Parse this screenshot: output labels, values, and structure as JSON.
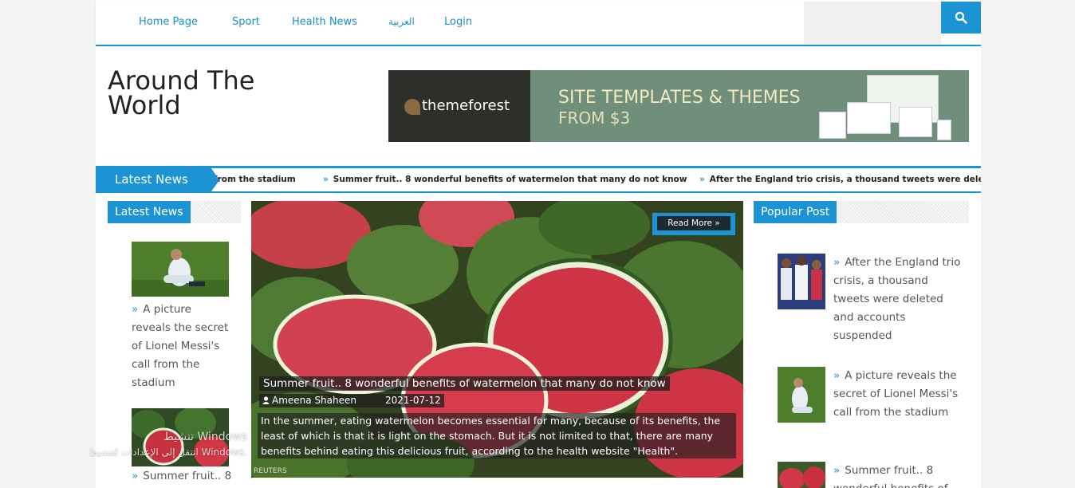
{
  "nav": {
    "items": [
      "Home Page",
      "Sport",
      "Health News",
      "العربية",
      "Login"
    ]
  },
  "site": {
    "title_line1": "Around The",
    "title_line2": "World"
  },
  "banner": {
    "brand": "themeforest",
    "line1": "SITE TEMPLATES & THEMES",
    "line2": "FROM $3"
  },
  "ticker": {
    "label": "Latest News",
    "items": [
      "from the stadium",
      "Summer fruit.. 8 wonderful benefits of watermelon that many do not know",
      "After the England trio crisis, a thousand tweets were deleted"
    ]
  },
  "latest": {
    "heading": "Latest News",
    "items": [
      {
        "title": "A picture reveals the secret of Lionel Messi's call from the stadium"
      },
      {
        "title": "Summer fruit.. 8"
      }
    ]
  },
  "hero": {
    "read_more": "Read More »",
    "title": "Summer fruit.. 8 wonderful benefits of watermelon that many do not know",
    "author": "Ameena Shaheen",
    "date": "2021-07-12",
    "excerpt": "In the summer, eating watermelon becomes essential for many, because of its benefits, the least of which is that it is light on the stomach. But it is not limited to that, there are many benefits behind eating this delicious fruit, according to the health website \"Health\".",
    "credit": "REUTERS"
  },
  "popular": {
    "heading": "Popular Post",
    "items": [
      {
        "title": "After the England trio crisis, a thousand tweets were deleted and accounts suspended"
      },
      {
        "title": "A picture reveals the secret of Lionel Messi's call from the stadium"
      },
      {
        "title": "Summer fruit.. 8 wonderful benefits of"
      }
    ]
  },
  "watermark": {
    "line1": "تنشيط Windows",
    "line2": "انتقل إلى الإعدادات لتنشيط Windows."
  },
  "colors": {
    "accent": "#1c94d3",
    "text": "#555555"
  },
  "icons": [
    "search-icon",
    "chevron-right-icon",
    "user-icon"
  ]
}
